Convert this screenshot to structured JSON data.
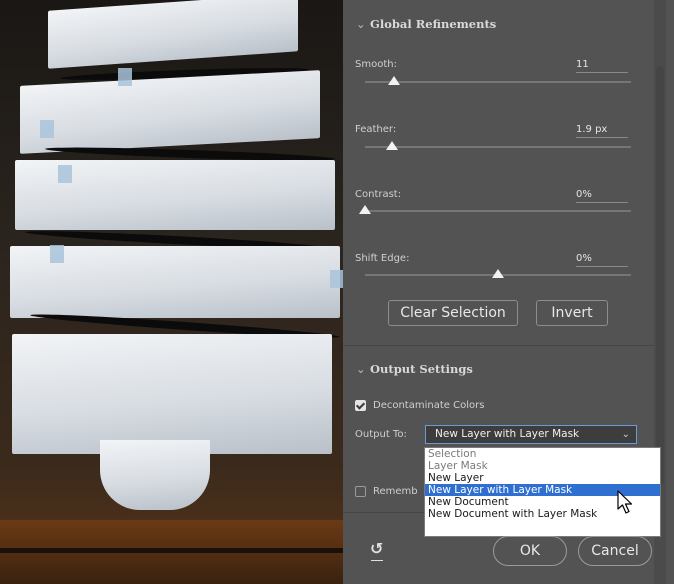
{
  "global_refinements": {
    "title": "Global Refinements",
    "smooth": {
      "label": "Smooth:",
      "value": "11",
      "level": 0.11
    },
    "feather": {
      "label": "Feather:",
      "value": "1.9 px",
      "level": 0.1
    },
    "contrast": {
      "label": "Contrast:",
      "value": "0%",
      "level": 0.0
    },
    "shift_edge": {
      "label": "Shift Edge:",
      "value": "0%",
      "level": 0.5
    },
    "clear_selection_label": "Clear Selection",
    "invert_label": "Invert"
  },
  "output_settings": {
    "title": "Output Settings",
    "decontaminate_label": "Decontaminate Colors",
    "decontaminate_checked": true,
    "output_to_label": "Output To:",
    "output_to_value": "New Layer with Layer Mask",
    "options": [
      {
        "label": "Selection",
        "enabled": false
      },
      {
        "label": "Layer Mask",
        "enabled": false
      },
      {
        "label": "New Layer",
        "enabled": true
      },
      {
        "label": "New Layer with Layer Mask",
        "enabled": true,
        "highlighted": true
      },
      {
        "label": "New Document",
        "enabled": true
      },
      {
        "label": "New Document with Layer Mask",
        "enabled": true
      }
    ],
    "remember_label": "Rememb",
    "remember_checked": false
  },
  "footer": {
    "ok_label": "OK",
    "cancel_label": "Cancel"
  },
  "colors": {
    "panel_bg": "#535353",
    "highlight": "#2f6fd0",
    "select_border": "#6b9ad6"
  }
}
